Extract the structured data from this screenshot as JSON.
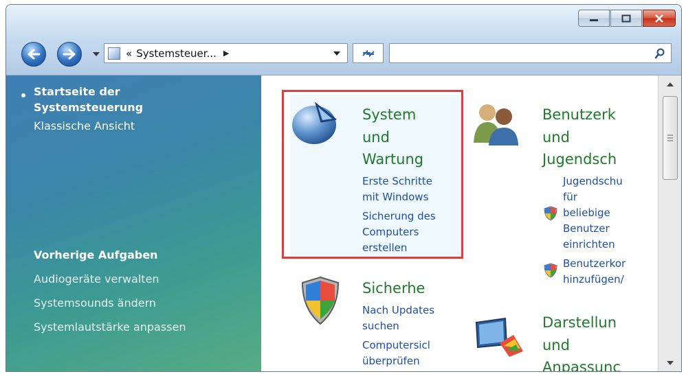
{
  "window": {
    "minimize_icon": "minimize-icon",
    "maximize_icon": "maximize-icon",
    "close_icon": "close-icon",
    "close_color": "#d34a31"
  },
  "toolbar": {
    "address_prefix": "«",
    "address_text": "Systemsteuer...",
    "address_sep": "▶",
    "search_placeholder": "",
    "search_icon": "search-icon"
  },
  "sidebar": {
    "home_line1": "Startseite der",
    "home_line2": "Systemsteuerung",
    "classic_view": "Klassische Ansicht",
    "previous_tasks_heading": "Vorherige Aufgaben",
    "tasks": [
      "Audiogeräte verwalten",
      "Systemsounds ändern",
      "Systemlautstärke anpassen"
    ]
  },
  "categories": {
    "system": {
      "title": [
        "System",
        "und",
        "Wartung"
      ],
      "links": [
        "Erste Schritte",
        "mit Windows",
        "Sicherung des",
        "Computers",
        "erstellen"
      ]
    },
    "users": {
      "title": [
        "Benutzerk",
        "und",
        "Jugendsch"
      ],
      "links": [
        "Jugendschu",
        "für",
        "beliebige",
        "Benutzer",
        "einrichten",
        "Benutzerkor",
        "hinzufügen/"
      ]
    },
    "security": {
      "title": "Sicherhe",
      "links": [
        "Nach Updates",
        "suchen",
        "Computersicl",
        "überprüfen"
      ]
    },
    "appearance": {
      "title": [
        "Darstellun",
        "und",
        "Anpassunc"
      ]
    }
  },
  "colors": {
    "category_title": "#1e7a2a",
    "link": "#1e4fa8",
    "highlight_border": "#e03c3c"
  }
}
